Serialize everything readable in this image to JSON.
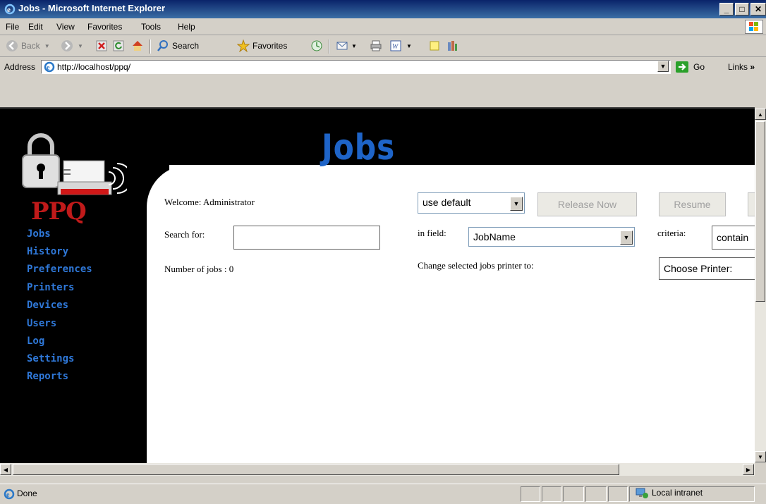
{
  "window": {
    "title": "Jobs - Microsoft Internet Explorer"
  },
  "menu": [
    {
      "label": "File",
      "key": "F"
    },
    {
      "label": "Edit",
      "key": "E"
    },
    {
      "label": "View",
      "key": "V"
    },
    {
      "label": "Favorites",
      "key": "a"
    },
    {
      "label": "Tools",
      "key": "T"
    },
    {
      "label": "Help",
      "key": "H"
    }
  ],
  "toolbar": {
    "back_label": "Back",
    "search_label": "Search",
    "favorites_label": "Favorites"
  },
  "address": {
    "label": "Address",
    "url": "http://localhost/ppq/",
    "go_label": "Go",
    "links_label": "Links"
  },
  "page": {
    "title": "Jobs",
    "logo_text": "PPQ",
    "nav": [
      "Jobs",
      "History",
      "Preferences",
      "Printers",
      "Devices",
      "Users",
      "Log",
      "Settings",
      "Reports"
    ],
    "welcome": "Welcome: Administrator",
    "search_label": "Search for:",
    "search_value": "",
    "job_count": "Number of jobs : 0",
    "priority_select": "use default",
    "release_label": "Release Now",
    "resume_label": "Resume",
    "in_field_label": "in field:",
    "field_select": "JobName",
    "criteria_label": "criteria:",
    "criteria_select": "contain",
    "change_printer_label": "Change selected jobs printer to:",
    "printer_select": "Choose Printer:"
  },
  "status": {
    "text": "Done",
    "zone": "Local intranet"
  },
  "colors": {
    "title_blue": "#1e64c8",
    "nav_blue": "#2f78d8",
    "logo_red": "#c01a1a"
  }
}
